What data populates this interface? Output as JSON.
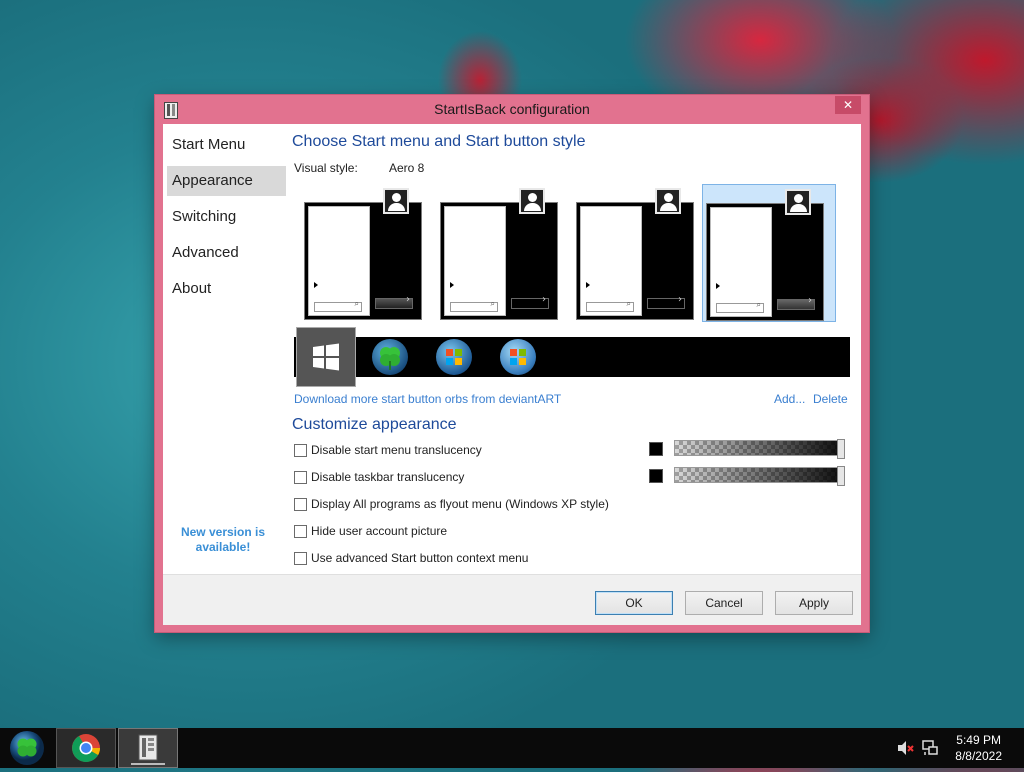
{
  "window": {
    "title": "StartIsBack configuration",
    "close_glyph": "✕"
  },
  "nav": {
    "items": [
      {
        "label": "Start Menu"
      },
      {
        "label": "Appearance"
      },
      {
        "label": "Switching"
      },
      {
        "label": "Advanced"
      },
      {
        "label": "About"
      }
    ],
    "selected": "Appearance",
    "new_version_line1": "New version is",
    "new_version_line2": "available!"
  },
  "main": {
    "style_heading": "Choose Start menu and Start button style",
    "visual_style_label": "Visual style:",
    "visual_style_value": "Aero 8",
    "style_thumbnails_count": 4,
    "selected_thumbnail": 4,
    "orbs": [
      "windows8-orb",
      "clover-orb",
      "windows7-orb-blue",
      "windows7-orb"
    ],
    "selected_orb": 1,
    "download_link": "Download more start button orbs from deviantART",
    "add_link": "Add...",
    "delete_link": "Delete",
    "customize_heading": "Customize appearance",
    "options": [
      {
        "label": "Disable start menu translucency",
        "checked": false
      },
      {
        "label": "Disable taskbar translucency",
        "checked": false
      },
      {
        "label": "Display All programs as flyout menu (Windows XP style)",
        "checked": false
      },
      {
        "label": "Hide user account picture",
        "checked": false
      },
      {
        "label": "Use advanced Start button context menu",
        "checked": false
      }
    ]
  },
  "footer": {
    "ok": "OK",
    "cancel": "Cancel",
    "apply": "Apply"
  },
  "taskbar": {
    "time": "5:49 PM",
    "date": "8/8/2022",
    "buttons": [
      "start-orb",
      "chrome",
      "startisback-config"
    ]
  },
  "colors": {
    "accent_frame": "#e2728f",
    "heading_blue": "#1e4a9a",
    "link_blue": "#3a7fd0",
    "selection_blue": "#cce5fb"
  }
}
